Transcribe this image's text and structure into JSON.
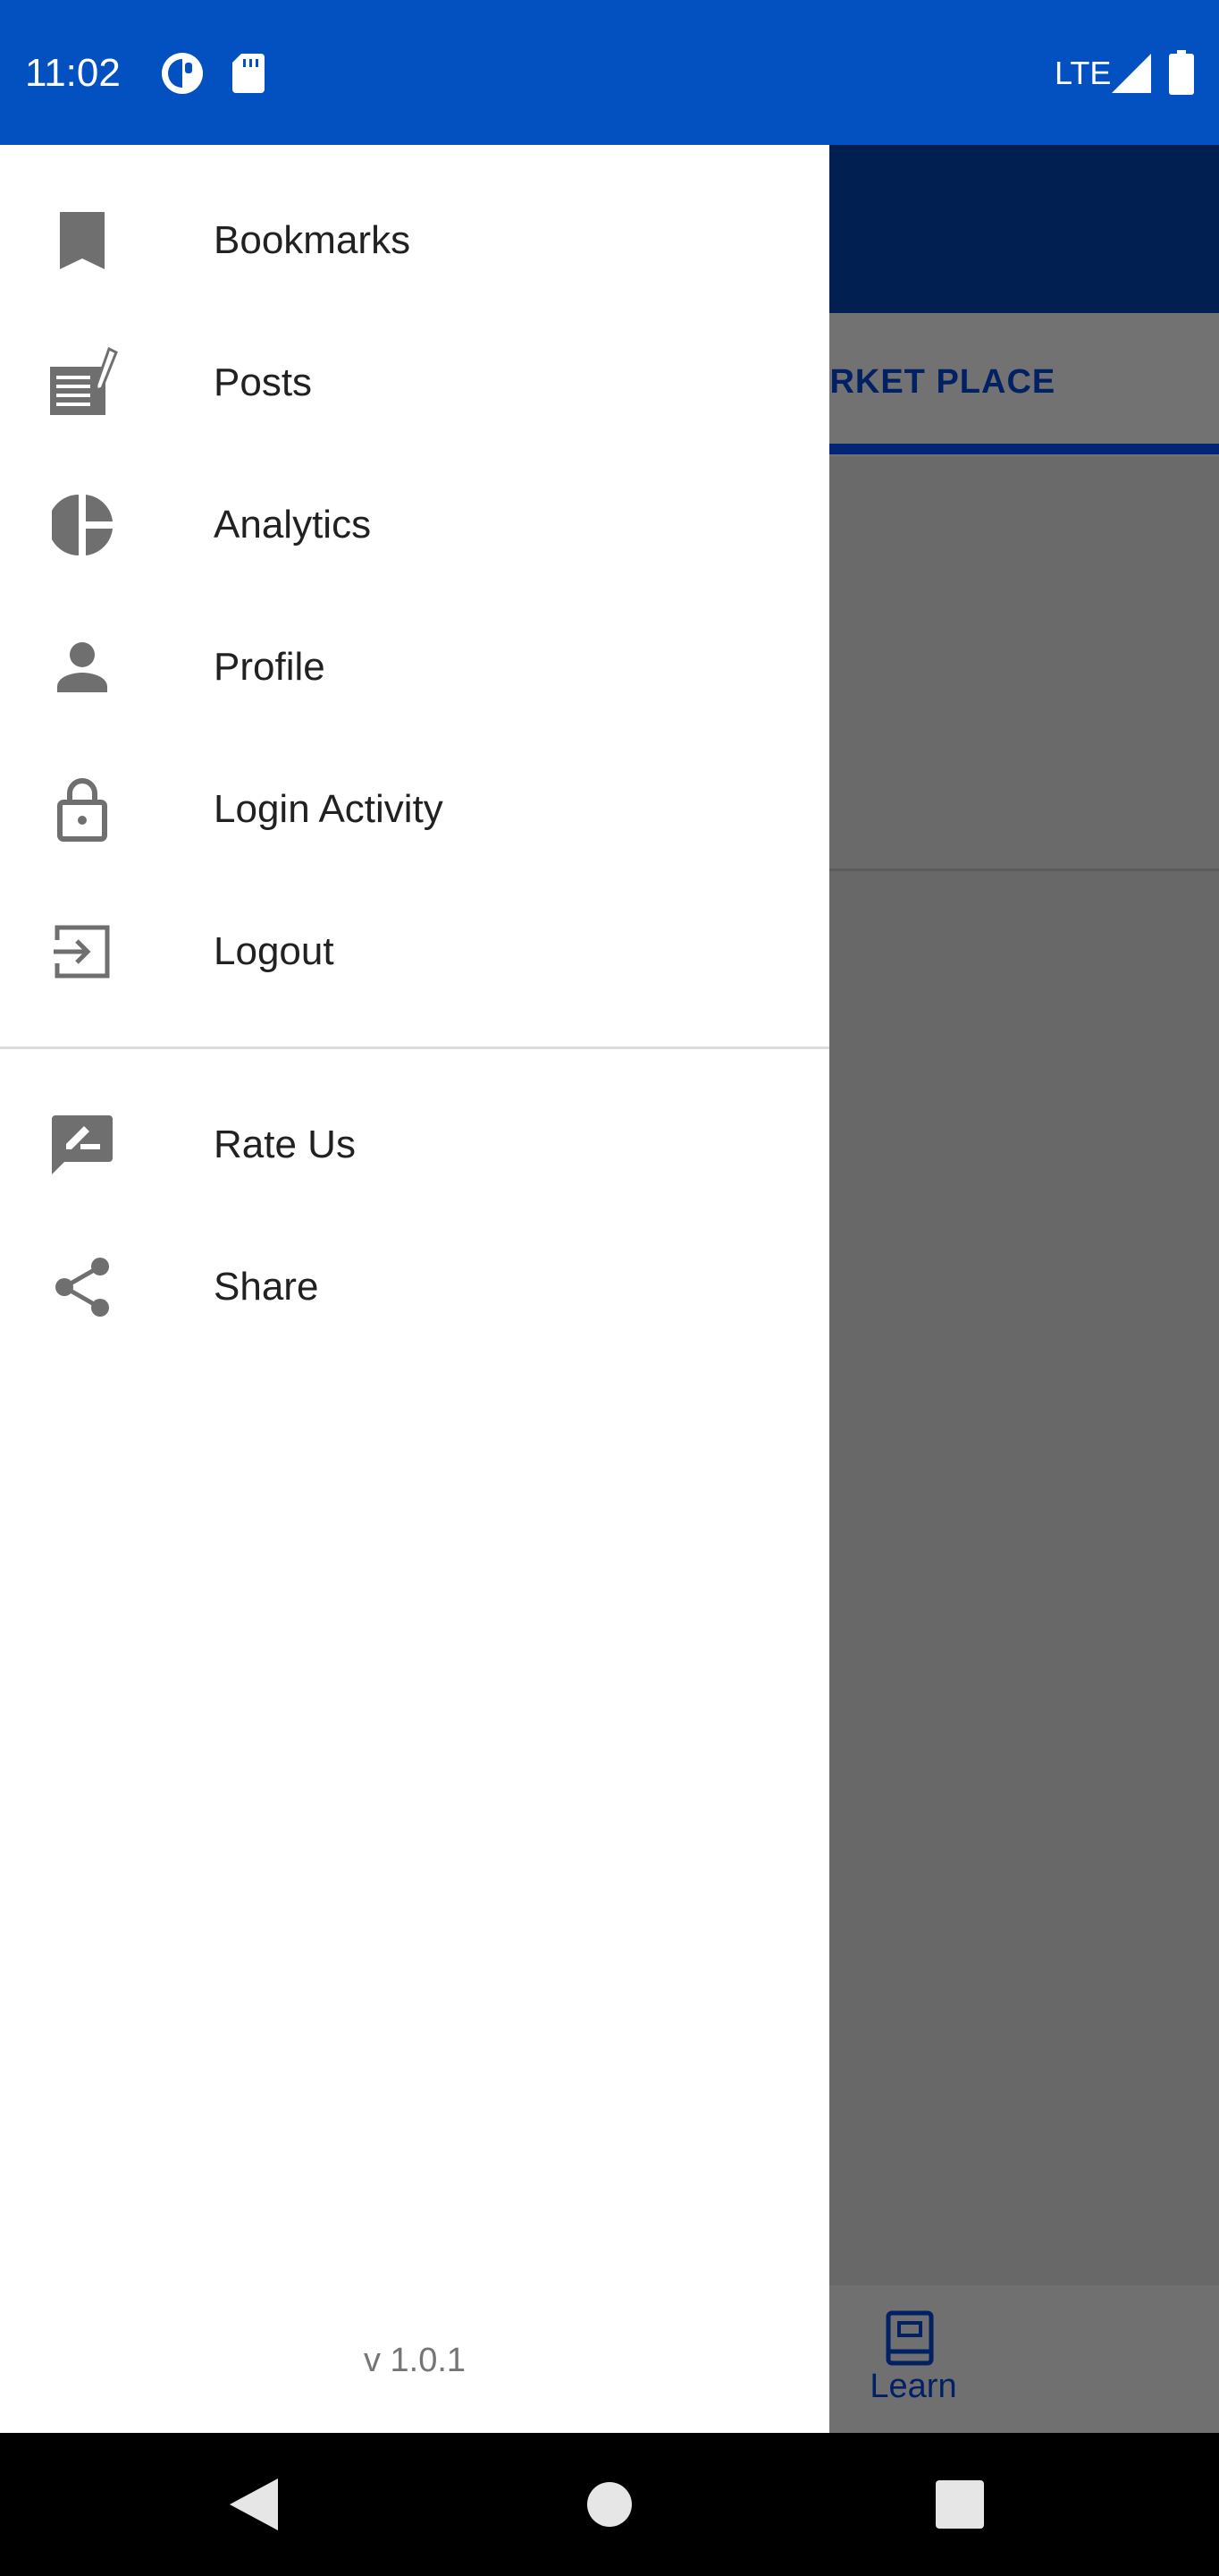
{
  "status_bar": {
    "time": "11:02",
    "network": "LTE",
    "icons": [
      "data-saver-icon",
      "sd-card-icon",
      "signal-icon",
      "battery-icon"
    ]
  },
  "background": {
    "tab_label": "ARKET PLACE",
    "bottom_nav": {
      "learn_label": "Learn"
    }
  },
  "drawer": {
    "items": [
      {
        "label": "Bookmarks",
        "icon": "bookmark-icon"
      },
      {
        "label": "Posts",
        "icon": "posts-icon"
      },
      {
        "label": "Analytics",
        "icon": "pie-chart-icon"
      },
      {
        "label": "Profile",
        "icon": "person-icon"
      },
      {
        "label": "Login Activity",
        "icon": "lock-icon"
      },
      {
        "label": "Logout",
        "icon": "logout-icon"
      }
    ],
    "secondary_items": [
      {
        "label": "Rate Us",
        "icon": "rate-review-icon"
      },
      {
        "label": "Share",
        "icon": "share-icon"
      }
    ],
    "version": "v 1.0.1"
  },
  "colors": {
    "status_bar": "#0350c1",
    "toolbar": "#011f51",
    "accent": "#022577",
    "icon_gray": "#6f6f6f",
    "text": "#212121"
  }
}
